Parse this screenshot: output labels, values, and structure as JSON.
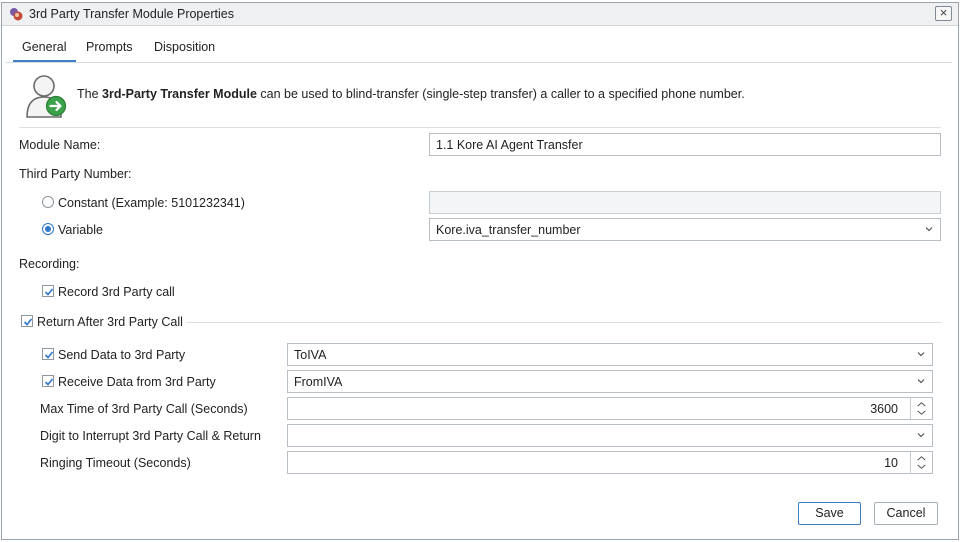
{
  "window": {
    "title": "3rd Party Transfer Module Properties",
    "close_icon": "close-icon"
  },
  "tabs": [
    {
      "label": "General",
      "active": true
    },
    {
      "label": "Prompts",
      "active": false
    },
    {
      "label": "Disposition",
      "active": false
    }
  ],
  "intro": {
    "prefix": "The ",
    "module_name_bold": "3rd-Party Transfer Module",
    "suffix": " can be used to blind-transfer (single-step transfer) a caller to a specified phone number.",
    "icon": "user-transfer-icon"
  },
  "form": {
    "module_name_label": "Module Name:",
    "module_name_value": "1.1 Kore AI Agent Transfer",
    "third_party_number_label": "Third Party Number:",
    "constant_label": "Constant (Example: 5101232341)",
    "constant_selected": false,
    "constant_value": "",
    "variable_label": "Variable",
    "variable_selected": true,
    "variable_value": "Kore.iva_transfer_number",
    "recording_label": "Recording:",
    "record_call_label": "Record 3rd Party call",
    "record_call_checked": true,
    "return_after_label": "Return After 3rd Party Call",
    "return_after_checked": true,
    "send_data_label": "Send Data to 3rd Party",
    "send_data_checked": true,
    "send_data_value": "ToIVA",
    "receive_data_label": "Receive Data from 3rd Party",
    "receive_data_checked": true,
    "receive_data_value": "FromIVA",
    "max_time_label": "Max Time of 3rd Party Call (Seconds)",
    "max_time_value": "3600",
    "digit_interrupt_label": "Digit to Interrupt 3rd Party Call & Return",
    "digit_interrupt_value": "",
    "ringing_timeout_label": "Ringing Timeout (Seconds)",
    "ringing_timeout_value": "10"
  },
  "buttons": {
    "save": "Save",
    "cancel": "Cancel"
  },
  "colors": {
    "accent": "#3d82c4",
    "border": "#b7bec5"
  }
}
